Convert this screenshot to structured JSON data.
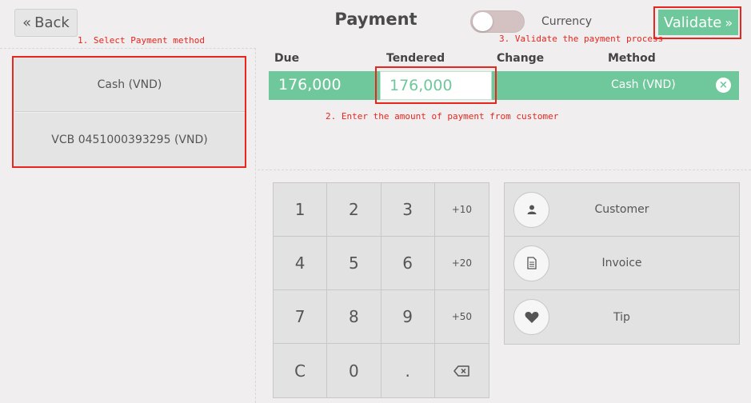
{
  "header": {
    "back_label": "Back",
    "back_icon": "«",
    "title": "Payment",
    "currency_label": "Currency",
    "validate_label": "Validate",
    "validate_icon": "»"
  },
  "annotations": {
    "step1": "1. Select Payment method",
    "step2": "2. Enter the amount of payment from customer",
    "step3": "3. Validate the payment process"
  },
  "payment_methods": [
    {
      "label": "Cash (VND)"
    },
    {
      "label": "VCB 0451000393295 (VND)"
    }
  ],
  "columns": {
    "due": "Due",
    "tendered": "Tendered",
    "change": "Change",
    "method": "Method"
  },
  "payment_line": {
    "due": "176,000",
    "tendered": "176,000",
    "change": "",
    "method": "Cash (VND)",
    "remove_icon": "×"
  },
  "numpad": {
    "keys": [
      "1",
      "2",
      "3",
      "+10",
      "4",
      "5",
      "6",
      "+20",
      "7",
      "8",
      "9",
      "+50",
      "C",
      "0",
      ".",
      "backspace"
    ]
  },
  "actions": [
    {
      "label": "Customer",
      "icon": "user-icon"
    },
    {
      "label": "Invoice",
      "icon": "document-icon"
    },
    {
      "label": "Tip",
      "icon": "heart-icon"
    }
  ],
  "colors": {
    "accent": "#6ec89b",
    "annotation": "#e8261e",
    "background": "#f0eeee"
  }
}
